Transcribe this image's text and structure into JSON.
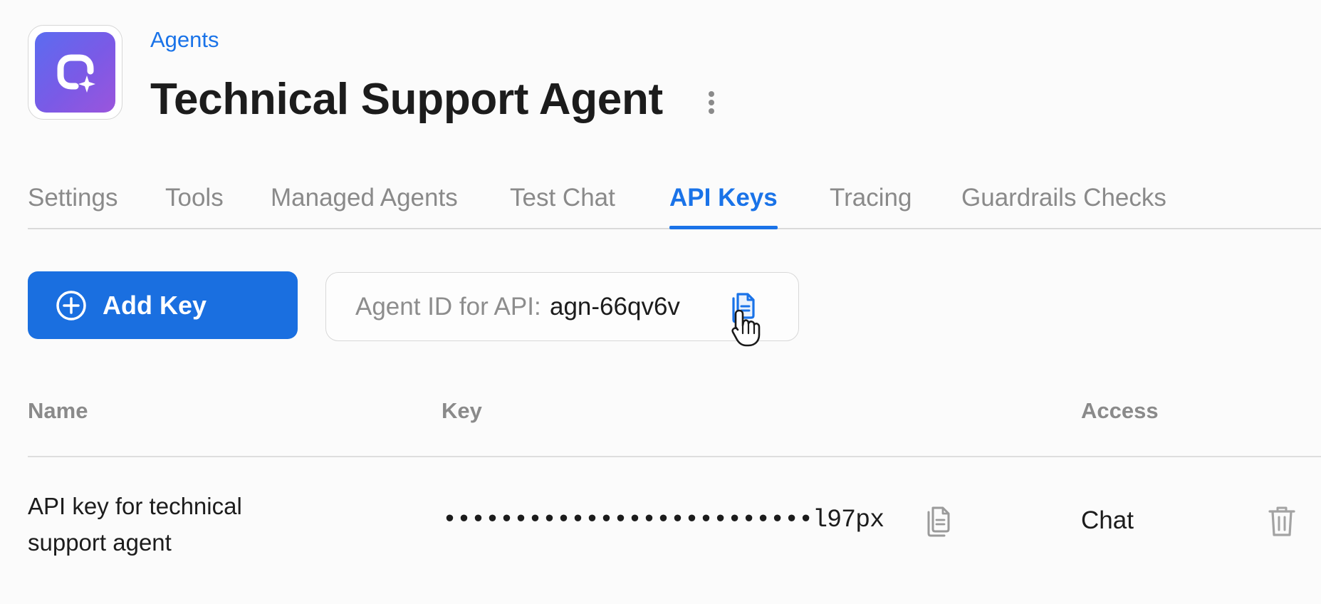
{
  "header": {
    "logo_icon": "agent-sparkle-icon",
    "breadcrumb": "Agents",
    "title": "Technical Support Agent",
    "menu_icon": "vertical-dots-icon"
  },
  "tabs": [
    {
      "label": "Settings",
      "active": false
    },
    {
      "label": "Tools",
      "active": false
    },
    {
      "label": "Managed Agents",
      "active": false
    },
    {
      "label": "Test Chat",
      "active": false
    },
    {
      "label": "API Keys",
      "active": true
    },
    {
      "label": "Tracing",
      "active": false
    },
    {
      "label": "Guardrails Checks",
      "active": false
    }
  ],
  "toolbar": {
    "add_key_label": "Add Key",
    "add_key_icon": "plus-circle-icon",
    "agent_id_label": "Agent ID for API:",
    "agent_id_value": "agn-66qv6v",
    "copy_icon": "copy-icon"
  },
  "table": {
    "columns": [
      "Name",
      "Key",
      "Access"
    ],
    "rows": [
      {
        "name": "API key for technical support agent",
        "key": "••••••••••••••••••••••••••l97px",
        "access": "Chat",
        "copy_icon": "copy-icon",
        "delete_icon": "trash-icon"
      }
    ]
  },
  "colors": {
    "accent": "#1a73e8",
    "button": "#1a6fe0",
    "muted_text": "#8a8a8a",
    "logo_gradient": [
      "#5b6cf0",
      "#9b55dc"
    ]
  }
}
